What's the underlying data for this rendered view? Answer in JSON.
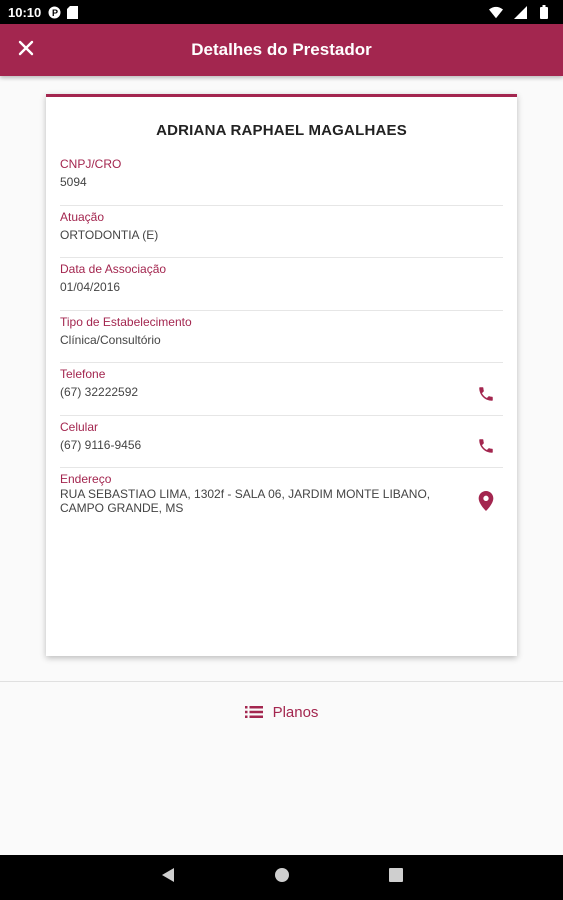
{
  "status_bar": {
    "time": "10:10"
  },
  "header": {
    "title": "Detalhes do Prestador",
    "close_icon": "close-icon"
  },
  "provider": {
    "name": "ADRIANA RAPHAEL MAGALHAES",
    "fields": [
      {
        "label": "CNPJ/CRO",
        "value": "5094"
      },
      {
        "label": "Atuação",
        "value": "ORTODONTIA (E)"
      },
      {
        "label": "Data de Associação",
        "value": "01/04/2016"
      },
      {
        "label": "Tipo de Estabelecimento",
        "value": "Clínica/Consultório"
      },
      {
        "label": "Telefone",
        "value": "(67) 32222592",
        "action_icon": "phone-icon"
      },
      {
        "label": "Celular",
        "value": "(67) 9116-9456",
        "action_icon": "phone-icon"
      },
      {
        "label": "Endereço",
        "value": "RUA SEBASTIAO LIMA, 1302f - SALA 06, JARDIM MONTE LIBANO, CAMPO GRANDE, MS",
        "action_icon": "location-pin-icon"
      }
    ]
  },
  "footer": {
    "planos_label": "Planos",
    "planos_icon": "list-icon"
  },
  "colors": {
    "primary": "#a3264f",
    "label": "#a3264f",
    "text": "#444444"
  }
}
